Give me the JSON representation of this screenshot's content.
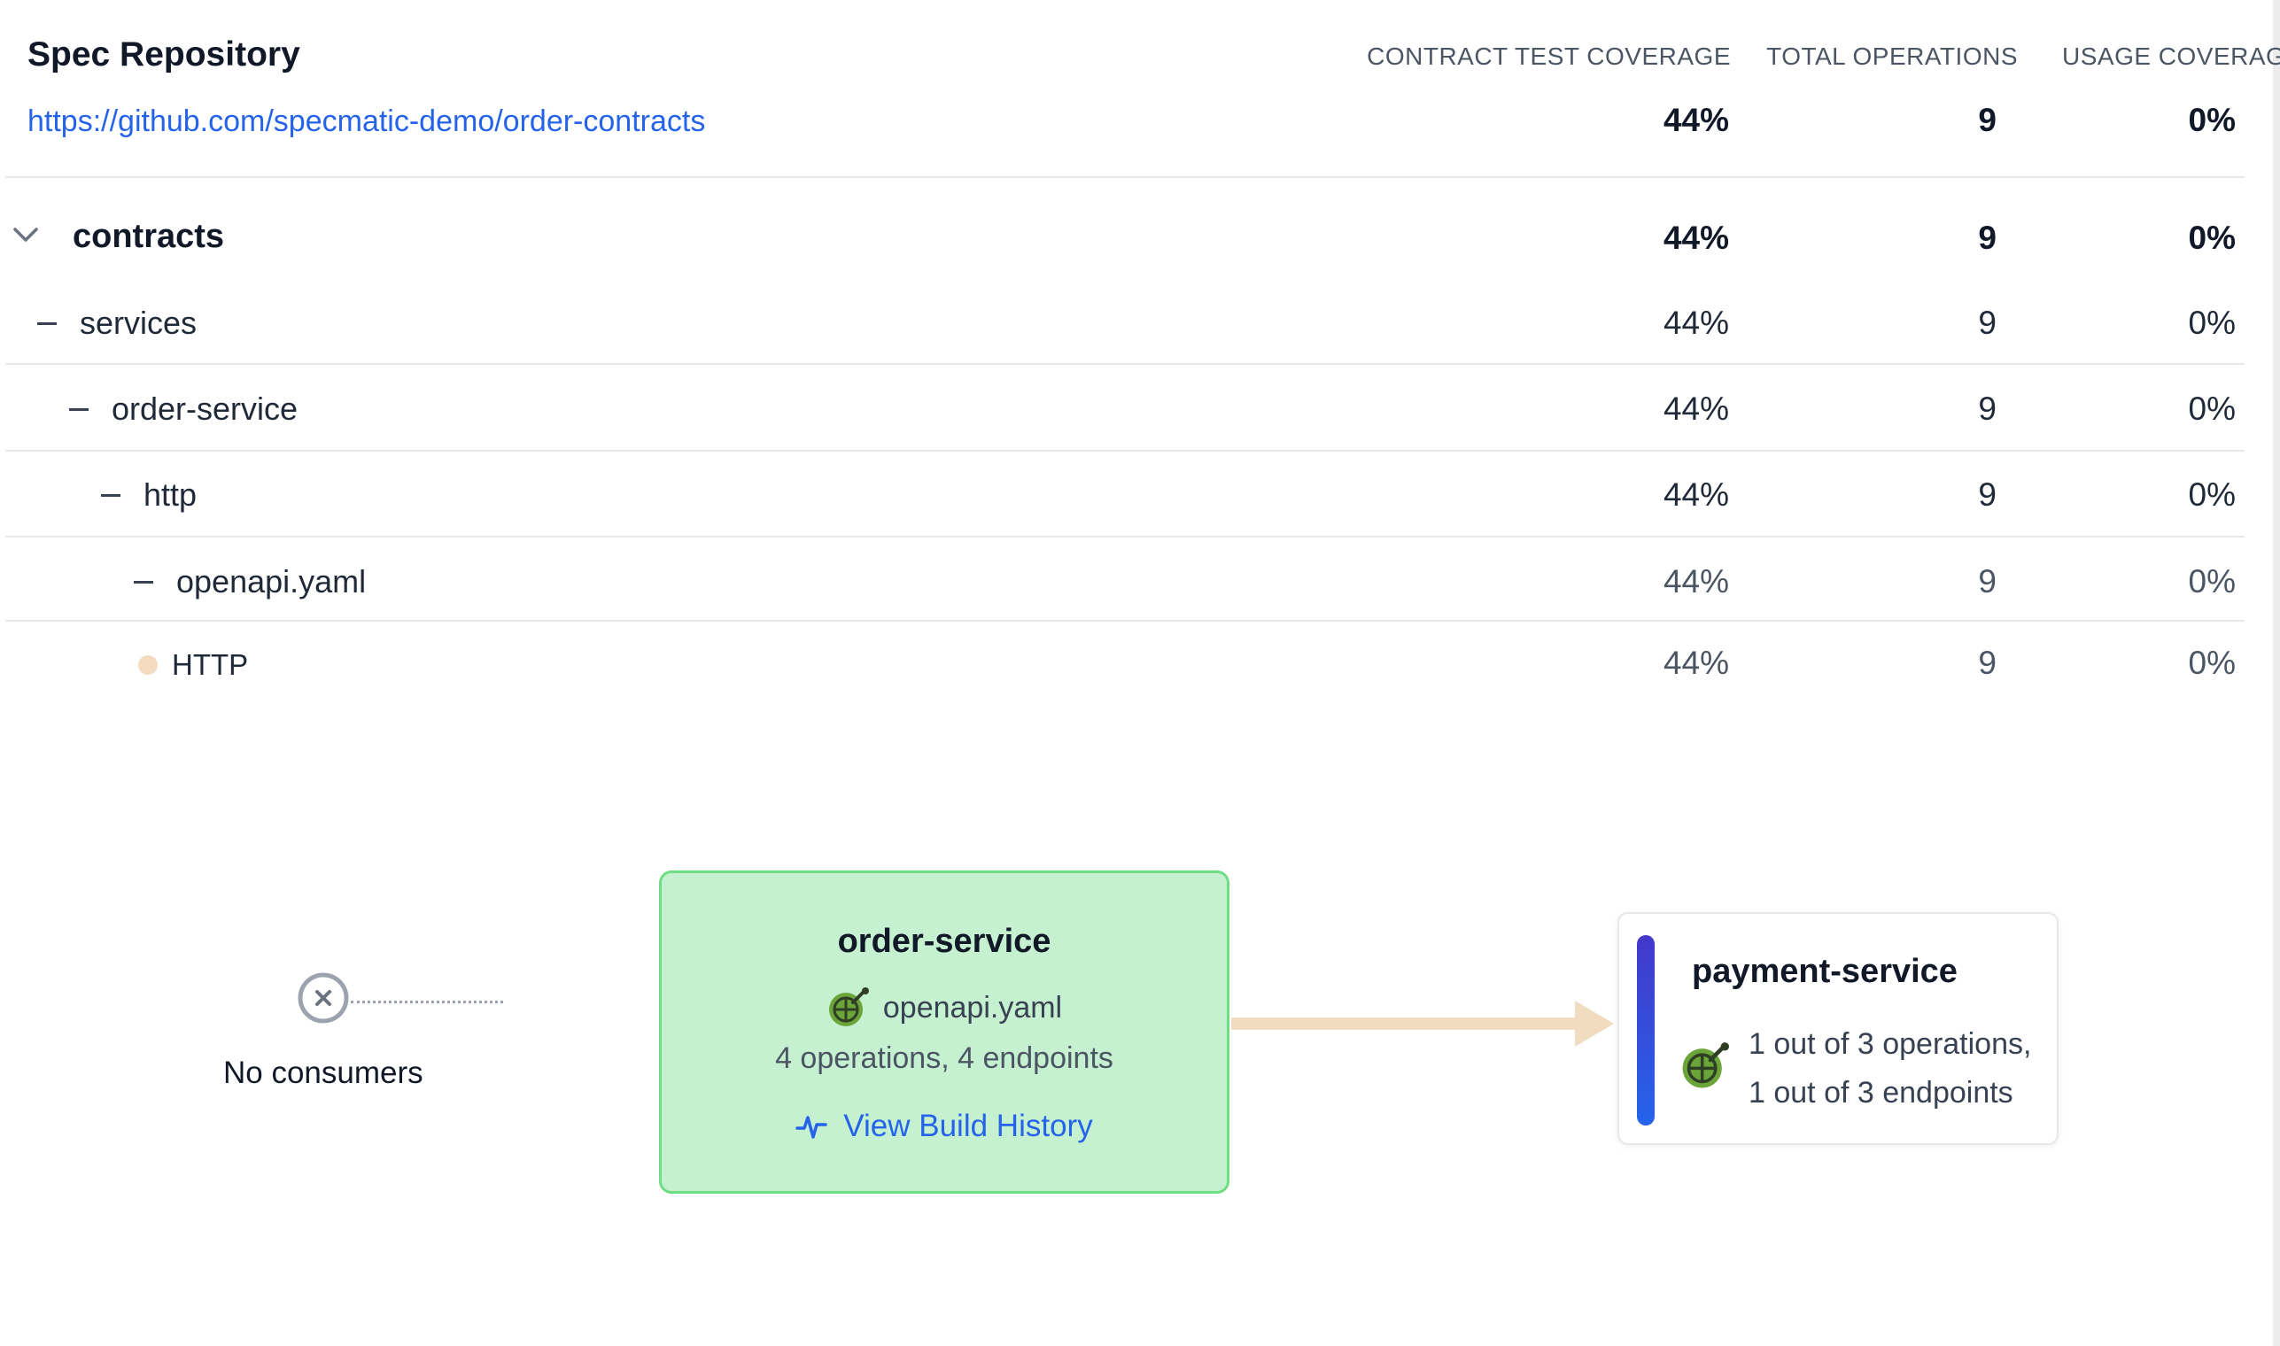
{
  "header": {
    "title": "Spec Repository",
    "repo_url": "https://github.com/specmatic-demo/order-contracts",
    "columns": [
      "CONTRACT TEST COVERAGE",
      "TOTAL OPERATIONS",
      "USAGE COVERAGE"
    ]
  },
  "repo_totals": {
    "coverage": "44%",
    "operations": "9",
    "usage": "0%"
  },
  "tree": [
    {
      "label": "contracts",
      "coverage": "44%",
      "operations": "9",
      "usage": "0%"
    },
    {
      "label": "services",
      "coverage": "44%",
      "operations": "9",
      "usage": "0%"
    },
    {
      "label": "order-service",
      "coverage": "44%",
      "operations": "9",
      "usage": "0%"
    },
    {
      "label": "http",
      "coverage": "44%",
      "operations": "9",
      "usage": "0%"
    },
    {
      "label": "openapi.yaml",
      "coverage": "44%",
      "operations": "9",
      "usage": "0%"
    },
    {
      "label": "HTTP",
      "coverage": "44%",
      "operations": "9",
      "usage": "0%"
    }
  ],
  "diagram": {
    "consumers_label": "No consumers",
    "service": {
      "name": "order-service",
      "spec_file": "openapi.yaml",
      "summary": "4 operations, 4 endpoints",
      "build_history_label": "View Build History"
    },
    "dependency": {
      "name": "payment-service",
      "line1": "1 out of 3 operations,",
      "line2": "1 out of 3 endpoints"
    }
  },
  "colors": {
    "link": "#2563eb",
    "service_box_bg": "#c6f1d0",
    "service_box_border": "#6fdd84",
    "arrow": "#f1dcc0",
    "dependency_bar": "#4338ca",
    "http_dot": "#f4dcc0"
  },
  "icons": [
    "chevron-down-icon",
    "no-consumer-x-icon",
    "openapi-icon",
    "activity-icon"
  ]
}
